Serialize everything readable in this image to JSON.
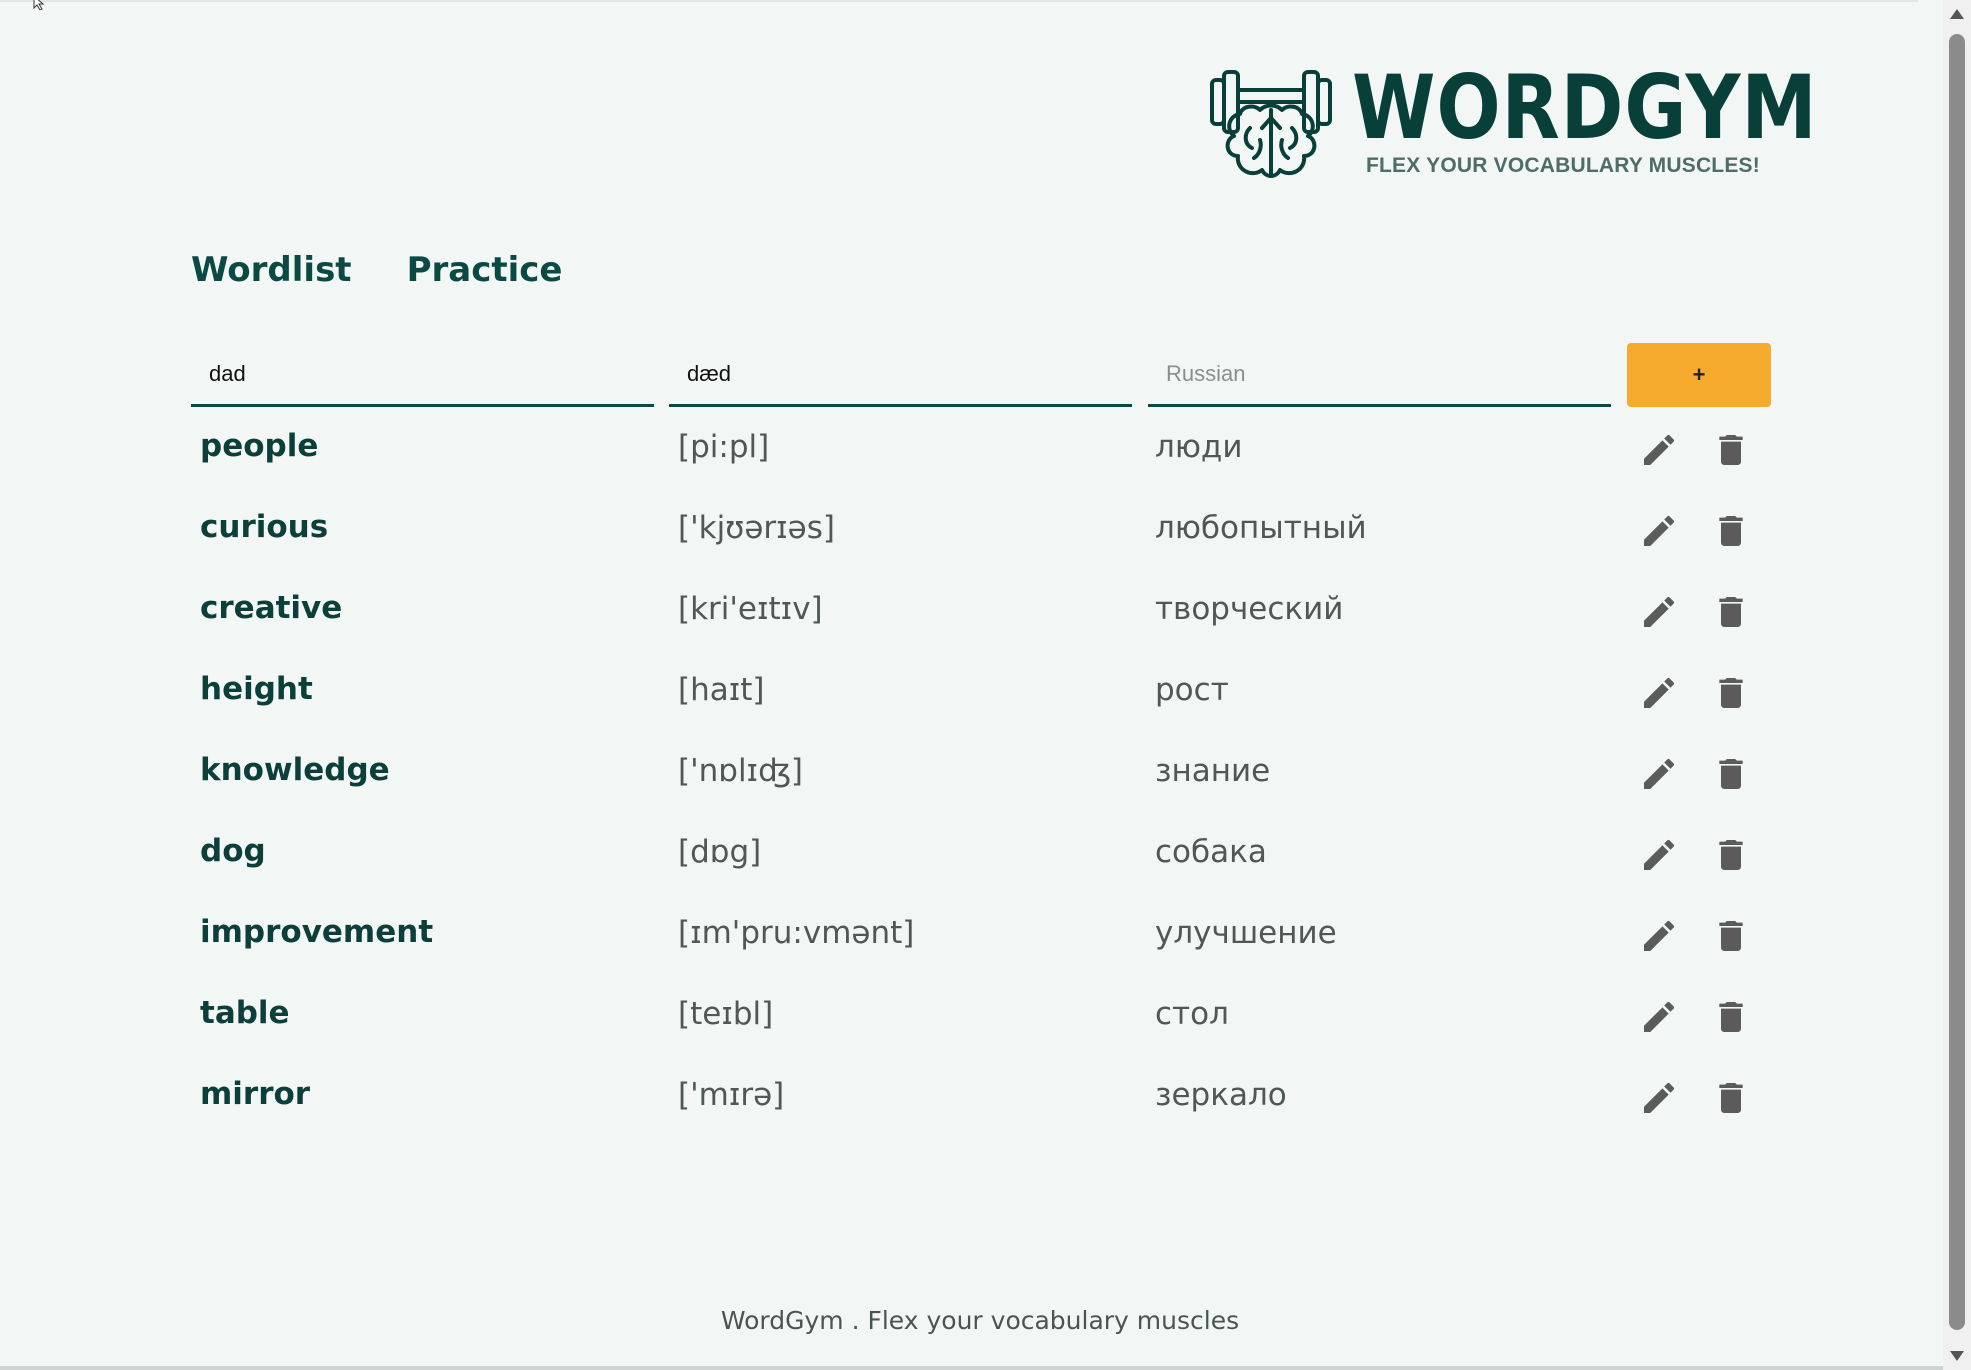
{
  "app": {
    "logo_title": "WORDGYM",
    "logo_tagline": "FLEX YOUR VOCABULARY MUSCLES!",
    "logo_icon": "brain-dumbbell-icon"
  },
  "nav": {
    "tabs": [
      {
        "label": "Wordlist"
      },
      {
        "label": "Practice"
      }
    ]
  },
  "form": {
    "word_value": "dad",
    "transcription_value": "dæd",
    "translation_placeholder": "Russian",
    "add_label": "+"
  },
  "words": [
    {
      "word": "people",
      "transcription": "[pi:pl]",
      "translation": "люди"
    },
    {
      "word": "curious",
      "transcription": "['kjʊərɪəs]",
      "translation": "любопытный"
    },
    {
      "word": "creative",
      "transcription": "[kri'eɪtɪv]",
      "translation": "творческий"
    },
    {
      "word": "height",
      "transcription": "[haɪt]",
      "translation": "рост"
    },
    {
      "word": "knowledge",
      "transcription": "['nɒlɪʤ]",
      "translation": "знание"
    },
    {
      "word": "dog",
      "transcription": "[dɒg]",
      "translation": "собака"
    },
    {
      "word": "improvement",
      "transcription": "[ɪm'pru:vmənt]",
      "translation": "улучшение"
    },
    {
      "word": "table",
      "transcription": "[teɪbl]",
      "translation": "стол"
    },
    {
      "word": "mirror",
      "transcription": "['mɪrə]",
      "translation": "зеркало"
    }
  ],
  "row_icons": {
    "edit": "pencil-icon",
    "delete": "trash-icon"
  },
  "footer": {
    "text": "WordGym . Flex your vocabulary muscles"
  },
  "colors": {
    "background": "#f2f6f4",
    "primary": "#0b4a43",
    "accent": "#f7ab2e",
    "icon": "#5b5b5b"
  }
}
